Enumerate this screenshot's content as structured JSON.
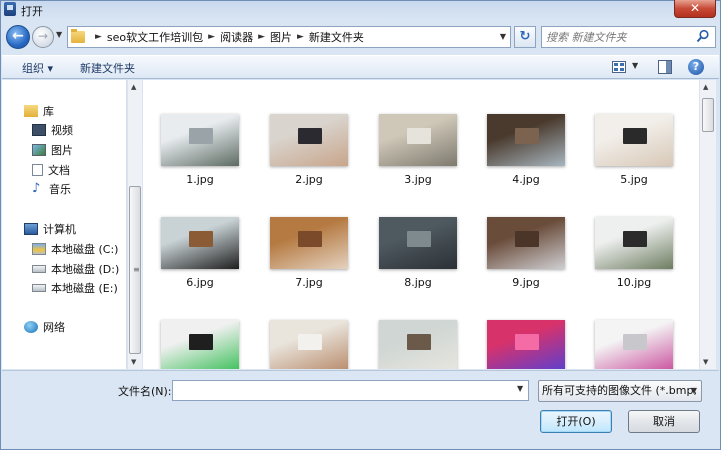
{
  "window": {
    "title": "打开",
    "close_label": "✕"
  },
  "address": {
    "crumbs": [
      "seo软文工作培训包",
      "阅读器",
      "图片",
      "新建文件夹"
    ],
    "search_placeholder": "搜索 新建文件夹"
  },
  "toolbar": {
    "organize_label": "组织 ▾",
    "new_folder_label": "新建文件夹",
    "help_label": "?"
  },
  "nav": {
    "libraries_label": "库",
    "library_items": [
      "视频",
      "图片",
      "文档",
      "音乐"
    ],
    "computer_label": "计算机",
    "drives": [
      "本地磁盘 (C:)",
      "本地磁盘 (D:)",
      "本地磁盘 (E:)"
    ],
    "network_label": "网络"
  },
  "files": [
    {
      "name": "1.jpg",
      "colors": [
        "#e8ecef",
        "#9aa3a8",
        "#5d6b63"
      ]
    },
    {
      "name": "2.jpg",
      "colors": [
        "#d9d4cd",
        "#2a2a30",
        "#c8a58b"
      ]
    },
    {
      "name": "3.jpg",
      "colors": [
        "#cfc7b8",
        "#e6e3dc",
        "#7d7a6e"
      ]
    },
    {
      "name": "4.jpg",
      "colors": [
        "#4a3a2d",
        "#7b6350",
        "#a7b6bf"
      ]
    },
    {
      "name": "5.jpg",
      "colors": [
        "#f2efea",
        "#2a2a2a",
        "#d7c8b7"
      ]
    },
    {
      "name": "6.jpg",
      "colors": [
        "#c9d3d6",
        "#8b5b36",
        "#1e1e1e"
      ]
    },
    {
      "name": "7.jpg",
      "colors": [
        "#b57a42",
        "#7a4a2a",
        "#e4d2c0"
      ]
    },
    {
      "name": "8.jpg",
      "colors": [
        "#4f5960",
        "#7f8a8f",
        "#2b3136"
      ]
    },
    {
      "name": "9.jpg",
      "colors": [
        "#6a4c3a",
        "#4b3428",
        "#cfcfd2"
      ]
    },
    {
      "name": "10.jpg",
      "colors": [
        "#eef0ef",
        "#2b2b2b",
        "#6e7d61"
      ]
    },
    {
      "name": "",
      "colors": [
        "#f0f0f0",
        "#1f1f1f",
        "#3bbf58"
      ]
    },
    {
      "name": "",
      "colors": [
        "#e9e4dc",
        "#f3f1ee",
        "#b88a6a"
      ]
    },
    {
      "name": "",
      "colors": [
        "#cfd6d3",
        "#6b5a4a",
        "#e8e6df"
      ]
    },
    {
      "name": "",
      "colors": [
        "#d8326b",
        "#f46ba6",
        "#5a3fd1"
      ]
    },
    {
      "name": "",
      "colors": [
        "#f4f4f4",
        "#c8c8cc",
        "#c94f9d"
      ]
    }
  ],
  "bottom": {
    "filename_label": "文件名(N):",
    "filename_value": "",
    "filter_label": "所有可支持的图像文件 (*.bmp;",
    "open_label": "打开(O)",
    "cancel_label": "取消"
  }
}
